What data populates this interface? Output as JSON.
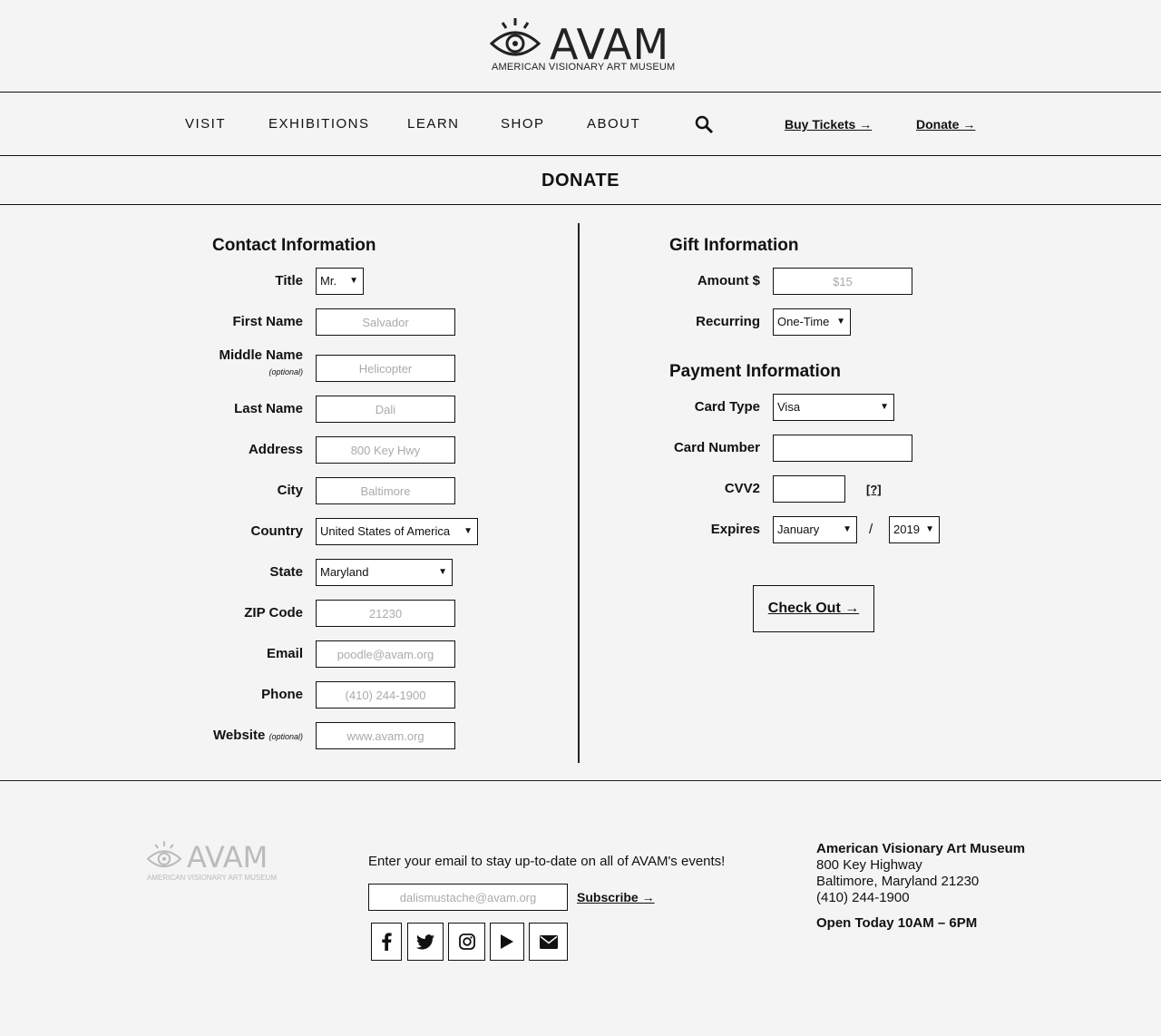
{
  "header": {
    "logo_word": "AVAM",
    "logo_sub": "AMERICAN VISIONARY ART MUSEUM"
  },
  "nav": {
    "items": [
      "VISIT",
      "EXHIBITIONS",
      "LEARN",
      "SHOP",
      "ABOUT"
    ],
    "buy_tickets": "Buy Tickets →",
    "donate": "Donate →"
  },
  "page": {
    "title": "DONATE"
  },
  "contact": {
    "title": "Contact Information",
    "title_label": "Title",
    "title_value": "Mr.",
    "first_name_label": "First Name",
    "first_name_placeholder": "Salvador",
    "middle_name_label": "Middle Name",
    "optional": "(optional)",
    "middle_name_placeholder": "Helicopter",
    "last_name_label": "Last Name",
    "last_name_placeholder": "Dali",
    "address_label": "Address",
    "address_placeholder": "800 Key Hwy",
    "city_label": "City",
    "city_placeholder": "Baltimore",
    "country_label": "Country",
    "country_value": "United States of America",
    "state_label": "State",
    "state_value": "Maryland",
    "zip_label": "ZIP Code",
    "zip_placeholder": "21230",
    "email_label": "Email",
    "email_placeholder": "poodle@avam.org",
    "phone_label": "Phone",
    "phone_placeholder": "(410) 244-1900",
    "website_label": "Website",
    "website_placeholder": "www.avam.org"
  },
  "gift": {
    "title": "Gift Information",
    "amount_label": "Amount $",
    "amount_placeholder": "$15",
    "recurring_label": "Recurring",
    "recurring_value": "One-Time"
  },
  "payment": {
    "title": "Payment Information",
    "card_type_label": "Card Type",
    "card_type_value": "Visa",
    "card_number_label": "Card Number",
    "cvv_label": "CVV2",
    "cvv_help": "[?]",
    "expires_label": "Expires",
    "expires_month": "January",
    "slash": "/",
    "expires_year": "2019",
    "checkout": "Check Out →"
  },
  "footer": {
    "logo_word": "AVAM",
    "logo_sub": "AMERICAN VISIONARY ART MUSEUM",
    "newsletter_text": "Enter your email to stay up-to-date on all of AVAM's events!",
    "email_placeholder": "dalismustache@avam.org",
    "subscribe": "Subscribe →",
    "social": [
      "facebook-icon",
      "twitter-icon",
      "instagram-icon",
      "youtube-icon",
      "email-icon"
    ],
    "museum_name": "American Visionary Art Museum",
    "street": "800 Key Highway",
    "city_line": "Baltimore, Maryland 21230",
    "phone": "(410) 244-1900",
    "hours": "Open Today 10AM – 6PM"
  }
}
